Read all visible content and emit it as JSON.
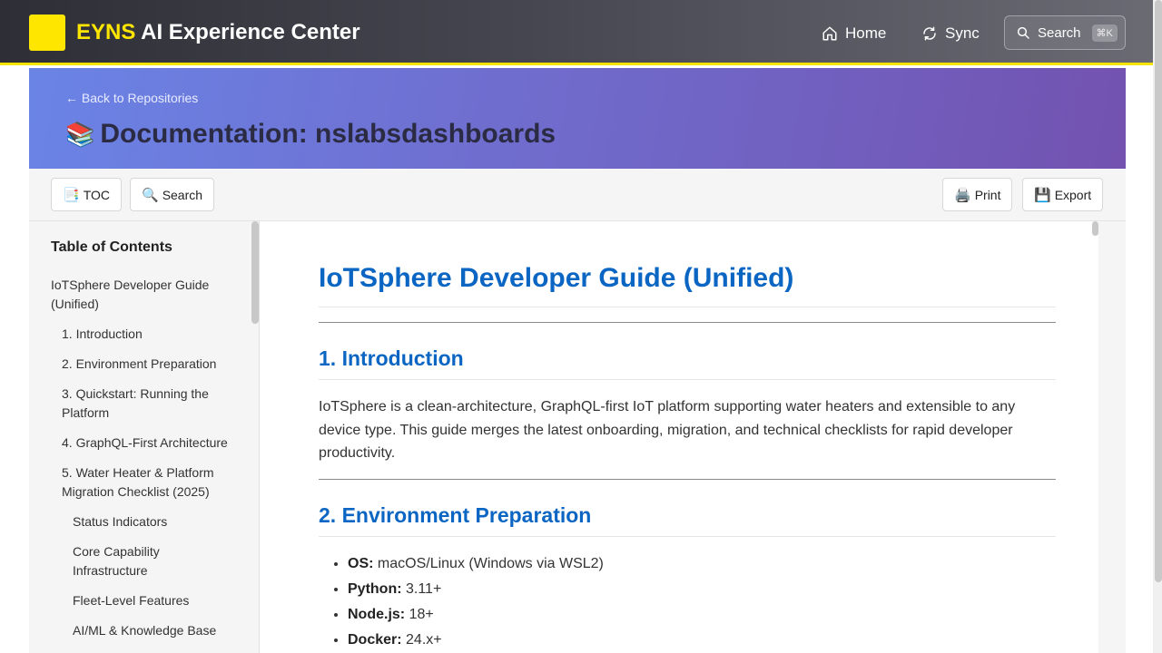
{
  "nav": {
    "brand_accent": "EYNS",
    "brand_rest": " AI Experience Center",
    "home_label": "Home",
    "sync_label": "Sync",
    "search_label": "Search",
    "search_shortcut": "⌘K",
    "accent_color": "#ffe600"
  },
  "header": {
    "back_link": "← Back to Repositories",
    "title_icon": "📚",
    "title": "Documentation: nslabsdashboards"
  },
  "toolbar": {
    "toc_icon": "📑",
    "toc_label": "TOC",
    "search_icon": "🔍",
    "search_label": "Search",
    "print_icon": "🖨️",
    "print_label": "Print",
    "export_icon": "💾",
    "export_label": "Export"
  },
  "sidebar": {
    "title": "Table of Contents",
    "items": [
      {
        "label": "IoTSphere Developer Guide (Unified)",
        "level": 1
      },
      {
        "label": "1. Introduction",
        "level": 2
      },
      {
        "label": "2. Environment Preparation",
        "level": 2
      },
      {
        "label": "3. Quickstart: Running the Platform",
        "level": 2
      },
      {
        "label": "4. GraphQL-First Architecture",
        "level": 2
      },
      {
        "label": "5. Water Heater & Platform Migration Checklist (2025)",
        "level": 2
      },
      {
        "label": "Status Indicators",
        "level": 3
      },
      {
        "label": "Core Capability Infrastructure",
        "level": 3
      },
      {
        "label": "Fleet-Level Features",
        "level": 3
      },
      {
        "label": "AI/ML & Knowledge Base",
        "level": 3
      }
    ]
  },
  "content": {
    "h1": "IoTSphere Developer Guide (Unified)",
    "intro_heading": "1. Introduction",
    "intro_text": "IoTSphere is a clean-architecture, GraphQL-first IoT platform supporting water heaters and extensible to any device type. This guide merges the latest onboarding, migration, and technical checklists for rapid developer productivity.",
    "env_heading": "2. Environment Preparation",
    "env_items": [
      {
        "key": "OS:",
        "value": " macOS/Linux (Windows via WSL2)"
      },
      {
        "key": "Python:",
        "value": " 3.11+"
      },
      {
        "key": "Node.js:",
        "value": " 18+"
      },
      {
        "key": "Docker:",
        "value": " 24.x+"
      }
    ]
  }
}
